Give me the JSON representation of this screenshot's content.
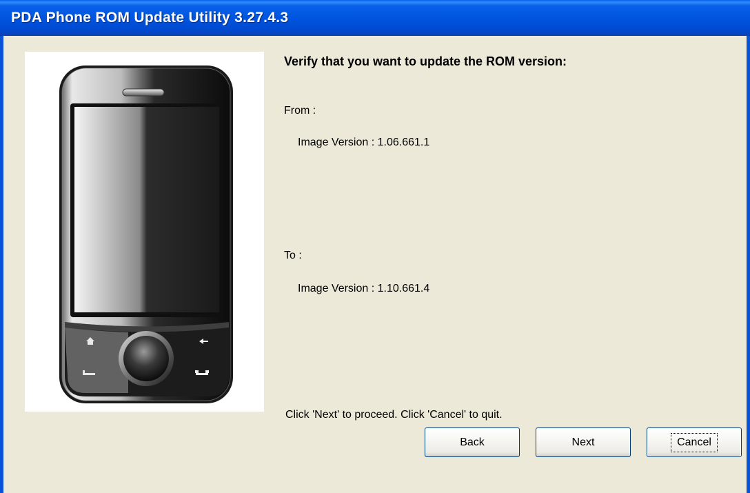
{
  "window": {
    "title": "PDA Phone ROM Update Utility 3.27.4.3"
  },
  "main": {
    "heading": "Verify that you want to update the ROM version:",
    "from_label": "From :",
    "from_version": "Image Version : 1.06.661.1",
    "to_label": "To :",
    "to_version": "Image Version : 1.10.661.4",
    "instruction": "Click 'Next' to proceed. Click 'Cancel' to quit."
  },
  "buttons": {
    "back": "Back",
    "next": "Next",
    "cancel": "Cancel"
  },
  "colors": {
    "titlebar": "#0055e0",
    "dialog_bg": "#ece9d8",
    "button_border": "#003c74"
  },
  "icons": [
    "phone-device-image",
    "home-icon",
    "back-arrow-icon",
    "call-icon",
    "end-call-icon"
  ]
}
